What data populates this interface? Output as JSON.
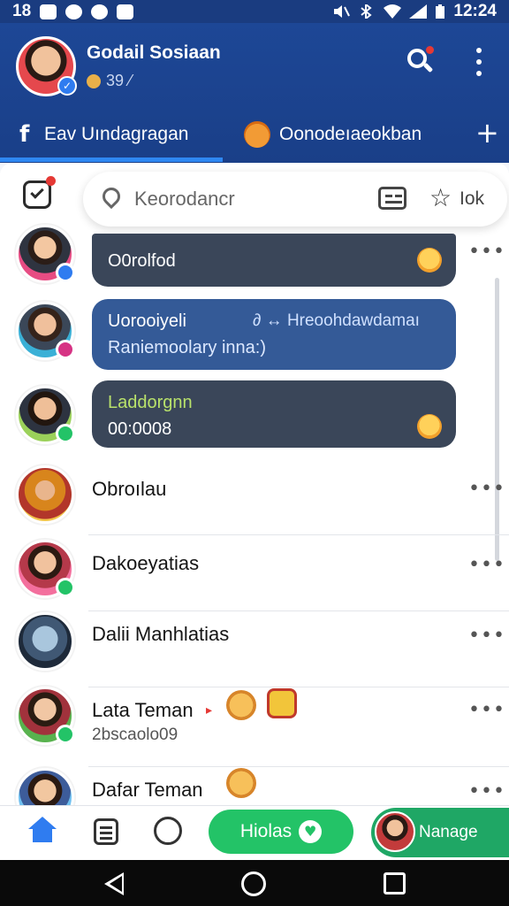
{
  "status_bar": {
    "left_text": "18",
    "time": "12:24"
  },
  "header": {
    "title": "Godail Sosiaan",
    "subtitle": "39",
    "subtitle_suffix": "⁄"
  },
  "tabs": [
    {
      "label": "Eav Uındagragan",
      "icon": "f"
    },
    {
      "label": "Oonodeıaeokban"
    }
  ],
  "tab_add": "+",
  "search": {
    "placeholder": "Keorodancr",
    "star_label": "Iok"
  },
  "chats": [
    {
      "text": "O0rolfod"
    },
    {
      "line1": "Uorooiyeli",
      "line1_right": "∂ ↔ Hreoohdawdamaı",
      "line2": "Raniemoolary inna:)"
    },
    {
      "line1": "Laddorgnn",
      "line2": "00:0008"
    }
  ],
  "contacts": [
    {
      "name": "Obroılau",
      "more": "•••"
    },
    {
      "name": "Dakoeyatias",
      "more": "•••"
    },
    {
      "name": "Dalii Manhlatias",
      "more": "•••"
    },
    {
      "name": "Lata Teman",
      "sub": "2bscaolo09",
      "more": "•••"
    },
    {
      "name": "Dafar Teman",
      "more": "•••"
    }
  ],
  "bottom_nav": {
    "cta_label": "Hiolas",
    "manage_label": "Nanage"
  },
  "colors": {
    "header_bg": "#1d4796",
    "tab_indicator": "#2f88f2",
    "bubble_dark": "#3a4659",
    "bubble_blue": "#345a97",
    "cta_green": "#23c367"
  }
}
